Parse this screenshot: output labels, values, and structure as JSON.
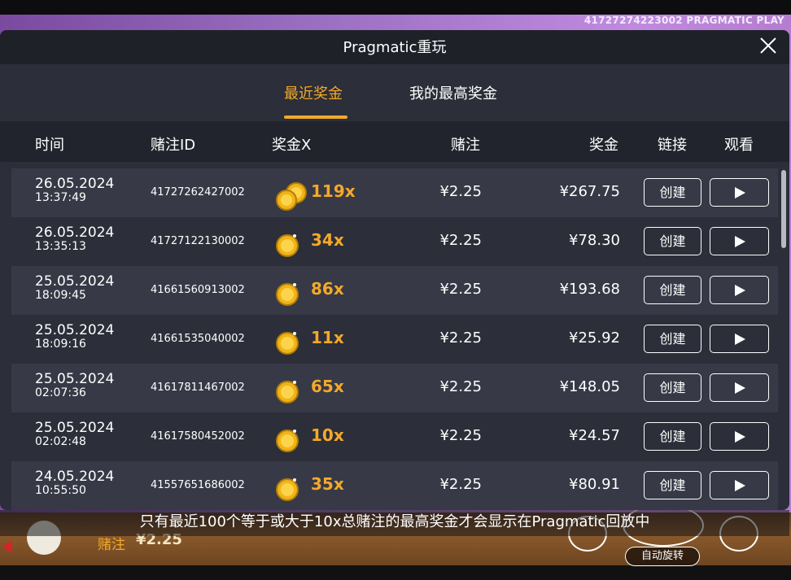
{
  "brand": {
    "round_id": "41727274223002",
    "logo_text": "PRAGMATIC PLAY"
  },
  "modal": {
    "title": "Pragmatic重玩",
    "tabs": [
      {
        "label": "最近奖金",
        "active": true
      },
      {
        "label": "我的最高奖金",
        "active": false
      }
    ],
    "columns": {
      "time": "时间",
      "bet_id": "赌注ID",
      "multiplier": "奖金X",
      "bet": "赌注",
      "win": "奖金",
      "link": "链接",
      "watch": "观看"
    },
    "rows": [
      {
        "date": "26.05.2024",
        "time": "13:37:49",
        "bet_id": "41727262427002",
        "multiplier": "119x",
        "bet": "¥2.25",
        "win": "¥267.75",
        "create": "创建",
        "coins": 2
      },
      {
        "date": "26.05.2024",
        "time": "13:35:13",
        "bet_id": "41727122130002",
        "multiplier": "34x",
        "bet": "¥2.25",
        "win": "¥78.30",
        "create": "创建",
        "coins": 1
      },
      {
        "date": "25.05.2024",
        "time": "18:09:45",
        "bet_id": "41661560913002",
        "multiplier": "86x",
        "bet": "¥2.25",
        "win": "¥193.68",
        "create": "创建",
        "coins": 1
      },
      {
        "date": "25.05.2024",
        "time": "18:09:16",
        "bet_id": "41661535040002",
        "multiplier": "11x",
        "bet": "¥2.25",
        "win": "¥25.92",
        "create": "创建",
        "coins": 1
      },
      {
        "date": "25.05.2024",
        "time": "02:07:36",
        "bet_id": "41617811467002",
        "multiplier": "65x",
        "bet": "¥2.25",
        "win": "¥148.05",
        "create": "创建",
        "coins": 1
      },
      {
        "date": "25.05.2024",
        "time": "02:02:48",
        "bet_id": "41617580452002",
        "multiplier": "10x",
        "bet": "¥2.25",
        "win": "¥24.57",
        "create": "创建",
        "coins": 1
      },
      {
        "date": "24.05.2024",
        "time": "10:55:50",
        "bet_id": "41557651686002",
        "multiplier": "35x",
        "bet": "¥2.25",
        "win": "¥80.91",
        "create": "创建",
        "coins": 1
      }
    ],
    "footnote": "只有最近100个等于或大于10x总赌注的最高奖金才会显示在Pragmatic回放中"
  },
  "game": {
    "bet_label": "赌注",
    "bet_value": "¥2.25",
    "autospin_label": "自动旋转"
  },
  "colors": {
    "accent": "#f3a92a",
    "modal_bg": "#2c2e39",
    "row_alt": "#373946"
  }
}
